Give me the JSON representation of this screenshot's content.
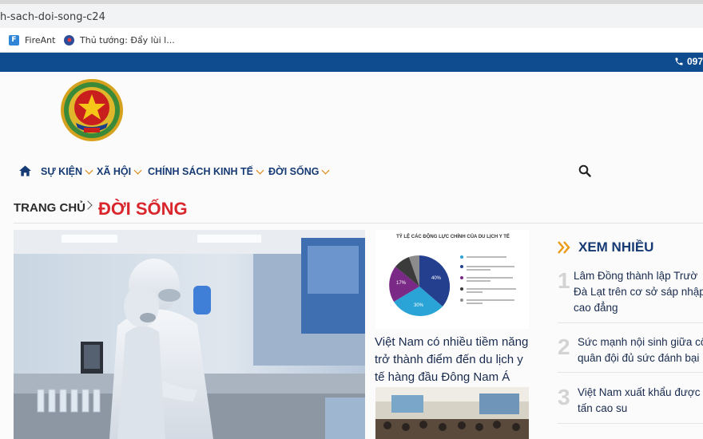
{
  "browser": {
    "url": "h-sach-doi-song-c24",
    "bookmarks": [
      {
        "label": "FireAnt",
        "icon": "fireant-icon",
        "color": "#2f86d6"
      },
      {
        "label": "Thủ tướng: Đẩy lùi l...",
        "icon": "gov-site-icon",
        "color": "#2b4d9b"
      }
    ]
  },
  "site": {
    "phone": "097",
    "brand_color": "#0f4c8f",
    "accent_color": "#d9262c"
  },
  "nav": {
    "home_icon": "home-icon",
    "items": [
      {
        "label": "SỰ KIỆN",
        "has_dropdown": true
      },
      {
        "label": "XÃ HỘI",
        "has_dropdown": true
      },
      {
        "label": "CHÍNH SÁCH",
        "has_dropdown": false
      },
      {
        "label": "KINH TẾ",
        "has_dropdown": true
      },
      {
        "label": "ĐỜI SỐNG",
        "has_dropdown": true
      }
    ],
    "search_icon": "search-icon"
  },
  "breadcrumb": {
    "home": "TRANG CHỦ",
    "current": "ĐỜI SỐNG"
  },
  "middle": {
    "infographic_title": "TỶ LỆ CÁC ĐỘNG LỰC CHÍNH CỦA DU LỊCH Y TẾ",
    "infographic_percents": [
      "40%",
      "30%",
      "17%"
    ],
    "article_title": "Việt Nam có nhiều tiềm năng trở thành điểm đến du lịch y tế hàng đầu Đông Nam Á"
  },
  "most_viewed": {
    "title": "XEM NHIỀU",
    "items": [
      {
        "num": "1",
        "lines": [
          "Lâm Đồng thành lập Trườ",
          "Đà Lạt trên cơ sở sáp nhập",
          "cao đẳng"
        ]
      },
      {
        "num": "2",
        "lines": [
          "Sức mạnh nội sinh giữa cô",
          "quân đội đủ sức đánh bại"
        ]
      },
      {
        "num": "3",
        "lines": [
          "Việt Nam xuất khẩu được",
          "tấn cao su"
        ]
      }
    ]
  }
}
